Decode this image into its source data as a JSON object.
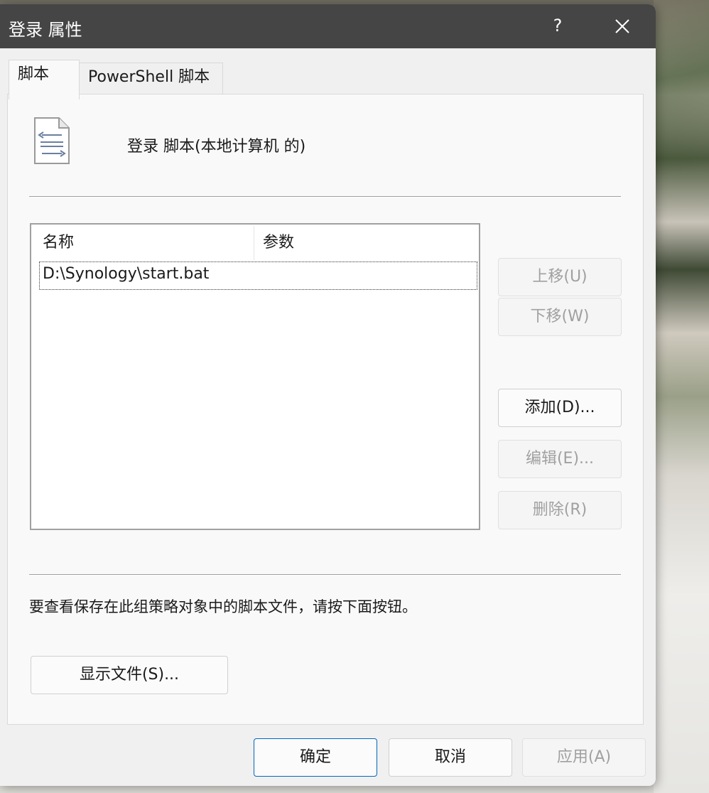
{
  "window": {
    "title": "登录 属性",
    "help_label": "?",
    "close_icon": "close-icon"
  },
  "tabs": [
    {
      "label": "脚本",
      "active": true
    },
    {
      "label": "PowerShell 脚本",
      "active": false
    }
  ],
  "header": {
    "icon": "script-document-icon",
    "label": "登录 脚本(本地计算机 的)"
  },
  "script_list": {
    "columns": [
      "名称",
      "参数"
    ],
    "rows": [
      {
        "name": "D:\\Synology\\start.bat",
        "params": ""
      }
    ]
  },
  "side_buttons": {
    "up": "上移(U)",
    "down": "下移(W)",
    "add": "添加(D)...",
    "edit": "编辑(E)...",
    "delete": "删除(R)"
  },
  "info_text": "要查看保存在此组策略对象中的脚本文件，请按下面按钮。",
  "show_files_button": "显示文件(S)...",
  "footer": {
    "ok": "确定",
    "cancel": "取消",
    "apply": "应用(A)"
  },
  "colors": {
    "titlebar": "#454545",
    "accent": "#0067c0",
    "disabled_text": "#a0a0a0"
  }
}
